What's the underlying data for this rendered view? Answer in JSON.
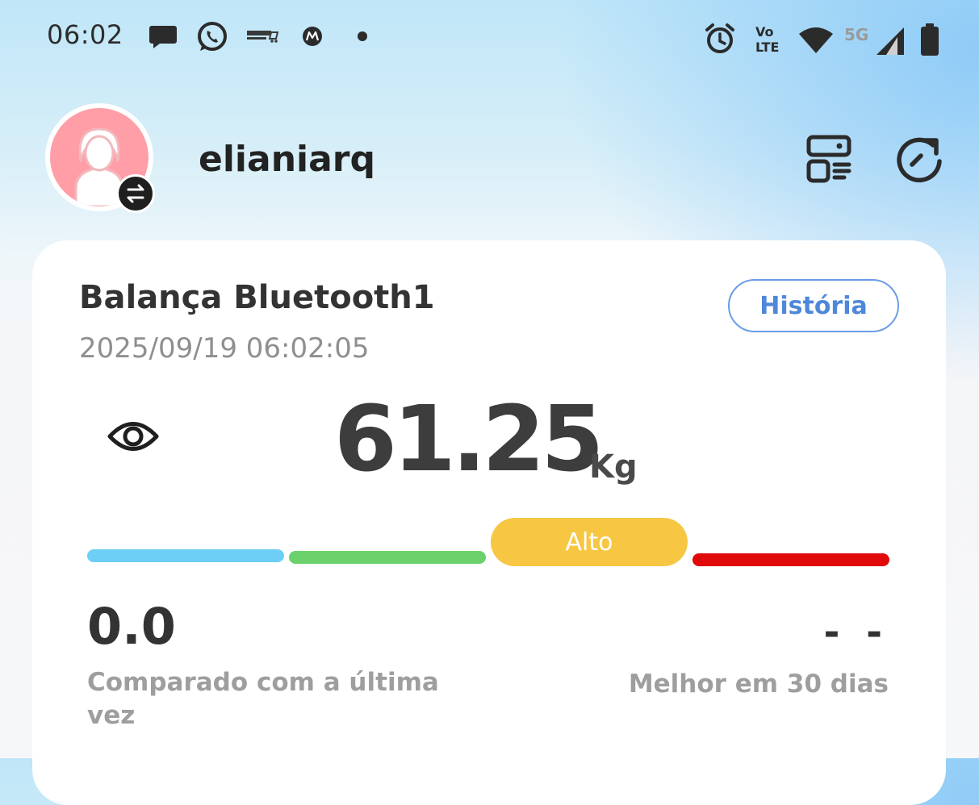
{
  "status_bar": {
    "time": "06:02",
    "left_icons": [
      "chat-bubble-icon",
      "whatsapp-icon",
      "delivery-app-icon",
      "motorola-icon",
      "notification-dot-icon"
    ],
    "right_icons": [
      "alarm-clock-icon",
      "volte-icon",
      "wifi-icon",
      "5g-signal-icon",
      "battery-icon"
    ],
    "volte_text_top": "Vo",
    "volte_text_bottom": "LTE",
    "network": "5G"
  },
  "header": {
    "username": "elianiarq",
    "avatar_icon": "user-avatar-icon",
    "swap_icon": "swap-arrows-icon",
    "actions": [
      "dashboard-layout-icon",
      "refresh-icon"
    ]
  },
  "card": {
    "scale_name": "Balança Bluetooth1",
    "datetime": "2025/09/19 06:02:05",
    "history_button": "História",
    "visibility_icon": "eye-icon",
    "weight": "61.25",
    "unit": "Kg",
    "level_label": "Alto",
    "level_segments": [
      {
        "color": "#6dcff5"
      },
      {
        "color": "#6bd26b"
      },
      {
        "color": "#f7c744"
      },
      {
        "color": "#e00a0a"
      }
    ],
    "comparison_value": "0.0",
    "comparison_label": "Comparado com a última vez",
    "best_value": "- -",
    "best_label": "Melhor em 30 dias"
  }
}
